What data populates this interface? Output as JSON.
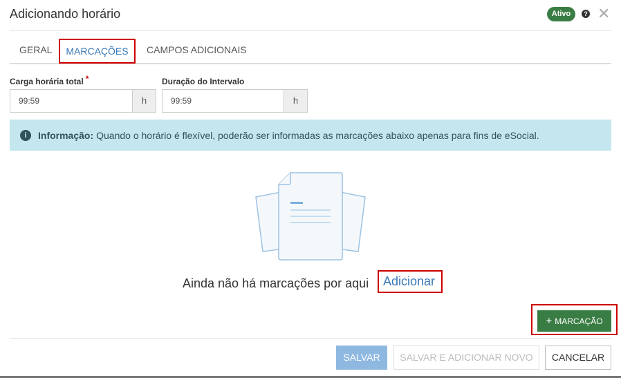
{
  "header": {
    "title": "Adicionando horário",
    "status_badge": "Ativo",
    "help_icon": "question-circle-icon",
    "close_icon": "close-icon"
  },
  "tabs": [
    {
      "label": "GERAL",
      "active": false
    },
    {
      "label": "MARCAÇÕES",
      "active": true
    },
    {
      "label": "CAMPOS ADICIONAIS",
      "active": false
    }
  ],
  "fields": {
    "carga": {
      "label": "Carga horária total",
      "required": "*",
      "value": "99:59",
      "unit": "h"
    },
    "intervalo": {
      "label": "Duração do Intervalo",
      "value": "99:59",
      "unit": "h"
    }
  },
  "info": {
    "icon": "info-circle-icon",
    "title": "Informação:",
    "text": "Quando o horário é flexível, poderão ser informadas as marcações abaixo apenas para fins de eSocial."
  },
  "empty_state": {
    "illustration": "documents-illustration",
    "text": "Ainda não há marcações por aqui",
    "link": "Adicionar"
  },
  "add_marcacao": {
    "icon": "plus-icon",
    "symbol": "+",
    "label": "MARCAÇÃO"
  },
  "footer": {
    "save": "SALVAR",
    "save_new": "SALVAR E ADICIONAR NOVO",
    "cancel": "CANCELAR"
  },
  "colors": {
    "accent": "#3a78b5",
    "success": "#3a7d44",
    "highlight": "#cc0000",
    "info_bg": "#c4e7ef"
  }
}
